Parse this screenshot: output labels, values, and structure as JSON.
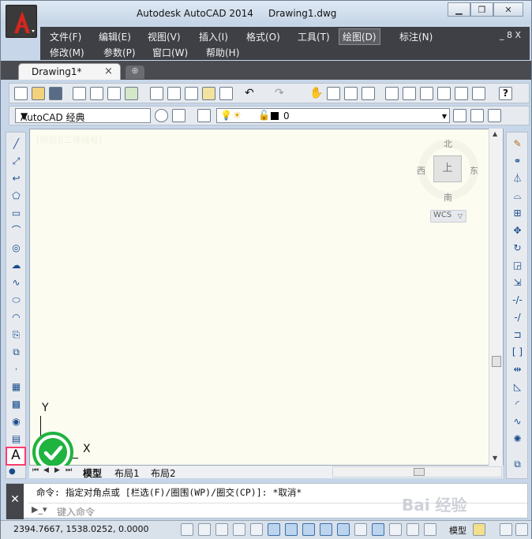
{
  "window": {
    "app_title": "Autodesk AutoCAD 2014",
    "doc_title": "Drawing1.dwg",
    "minimize": "0",
    "restore": "□",
    "close": "X"
  },
  "menu": {
    "row1": [
      "文件(F)",
      "编辑(E)",
      "视图(V)",
      "插入(I)",
      "格式(O)",
      "工具(T)",
      "绘图(D)",
      "标注(N)"
    ],
    "row2": [
      "修改(M)",
      "参数(P)",
      "窗口(W)",
      "帮助(H)"
    ],
    "selected": "绘图(D)",
    "doc_controls": "_ 8 X"
  },
  "tabs": {
    "active": "Drawing1*",
    "close": "×"
  },
  "toolbar2": {
    "workspace": "AutoCAD 经典",
    "layer": "0"
  },
  "viewport": {
    "label": "[俯视][二维线框]",
    "viewcube_face": "上",
    "north": "北",
    "south": "南",
    "east": "东",
    "west": "西",
    "wcs": "WCS"
  },
  "ucs": {
    "y": "Y",
    "x": "X"
  },
  "layout_tabs": [
    "模型",
    "布局1",
    "布局2"
  ],
  "command": {
    "history": "命令: 指定对角点或 [栏选(F)/圈围(WP)/圈交(CP)]: *取消*",
    "placeholder": "键入命令",
    "close": "✕"
  },
  "status": {
    "coordinates": "2394.7667, 1538.0252, 0.0000",
    "model": "模型"
  },
  "left_tool_highlight": "A",
  "watermark": "Bai 经验",
  "colors": {
    "accent_highlight": "#ff3b6b",
    "check_green": "#1fb33f",
    "canvas": "#fcfcf0",
    "menubar": "#3f4046"
  }
}
